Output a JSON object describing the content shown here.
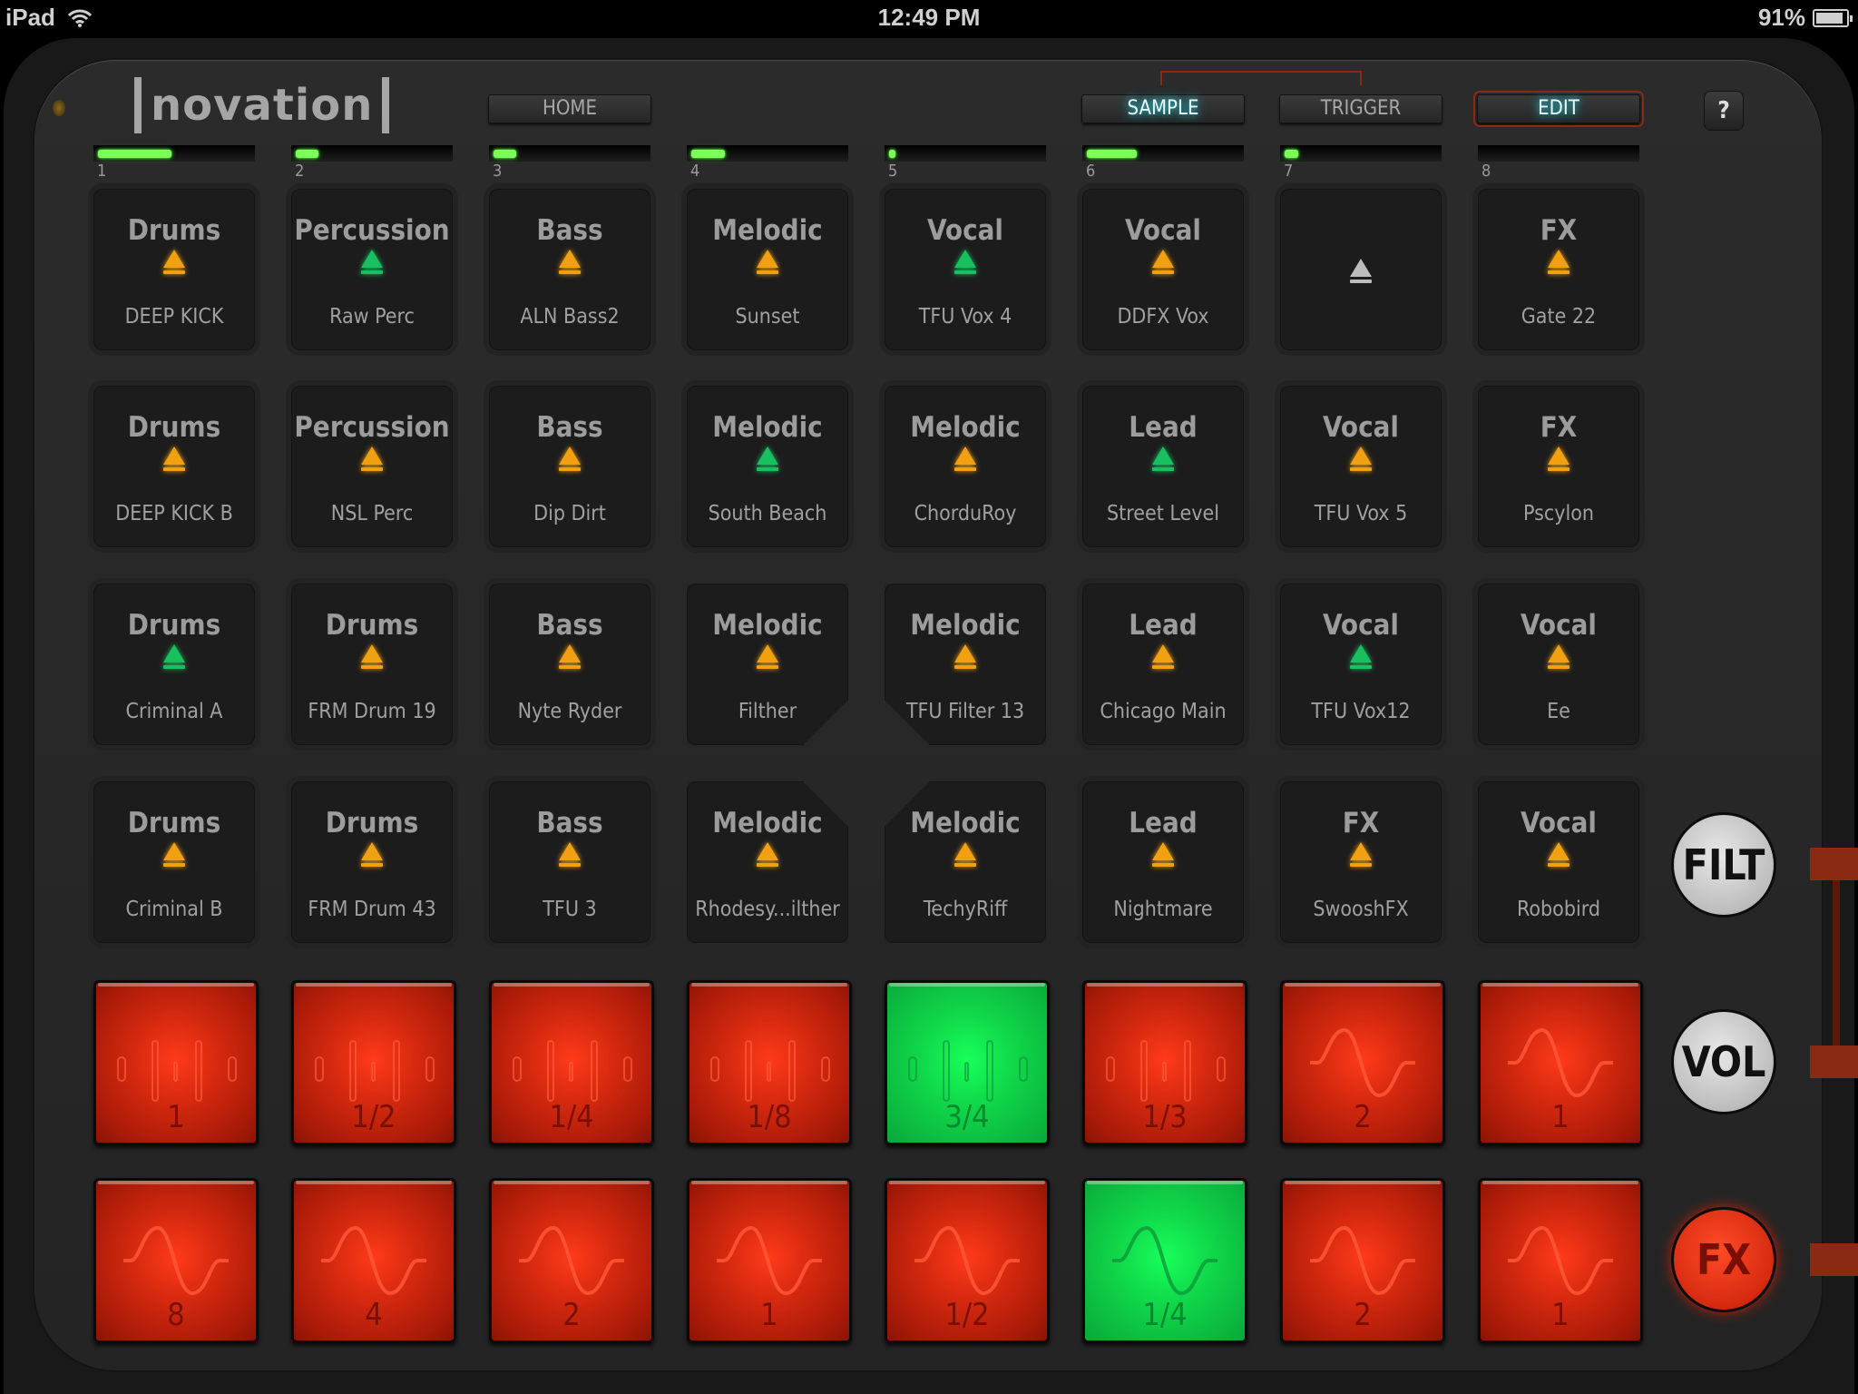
{
  "status_bar": {
    "device": "iPad",
    "wifi_icon": "wifi-icon",
    "time": "12:49 PM",
    "battery_text": "91%",
    "battery_level": 0.91
  },
  "header": {
    "logo": "novation",
    "home_label": "HOME",
    "sample_label": "SAMPLE",
    "trigger_label": "TRIGGER",
    "edit_label": "EDIT",
    "help_label": "?",
    "active_mode": "SAMPLE"
  },
  "colors": {
    "meter_green": "#7dff5a",
    "eject_orange": "#f0a010",
    "eject_green": "#18c060",
    "eject_empty": "#bdbdbd",
    "pad_red": "#d82a10",
    "pad_green": "#10d84a",
    "mode_highlight": "#2fd0d8",
    "bracket_red": "#8a2a14"
  },
  "meters": [
    {
      "label": "1",
      "level": 0.48
    },
    {
      "label": "2",
      "level": 0.15
    },
    {
      "label": "3",
      "level": 0.15
    },
    {
      "label": "4",
      "level": 0.22
    },
    {
      "label": "5",
      "level": 0.04
    },
    {
      "label": "6",
      "level": 0.33
    },
    {
      "label": "7",
      "level": 0.09
    },
    {
      "label": "8",
      "level": 0.0
    }
  ],
  "sample_pads": [
    [
      {
        "category": "Drums",
        "name": "DEEP KICK",
        "state": "orange"
      },
      {
        "category": "Percussion",
        "name": "Raw Perc",
        "state": "green"
      },
      {
        "category": "Bass",
        "name": "ALN Bass2",
        "state": "orange"
      },
      {
        "category": "Melodic",
        "name": "Sunset",
        "state": "orange"
      },
      {
        "category": "Vocal",
        "name": "TFU Vox 4",
        "state": "green"
      },
      {
        "category": "Vocal",
        "name": "DDFX Vox",
        "state": "orange"
      },
      {
        "category": "",
        "name": "",
        "state": "empty"
      },
      {
        "category": "FX",
        "name": "Gate 22",
        "state": "orange"
      }
    ],
    [
      {
        "category": "Drums",
        "name": "DEEP KICK B",
        "state": "orange"
      },
      {
        "category": "Percussion",
        "name": "NSL Perc",
        "state": "orange"
      },
      {
        "category": "Bass",
        "name": "Dip Dirt",
        "state": "orange"
      },
      {
        "category": "Melodic",
        "name": "South Beach",
        "state": "green"
      },
      {
        "category": "Melodic",
        "name": "ChorduRoy",
        "state": "orange"
      },
      {
        "category": "Lead",
        "name": "Street Level",
        "state": "green"
      },
      {
        "category": "Vocal",
        "name": "TFU Vox 5",
        "state": "orange"
      },
      {
        "category": "FX",
        "name": "Pscylon",
        "state": "orange"
      }
    ],
    [
      {
        "category": "Drums",
        "name": "Criminal A",
        "state": "green"
      },
      {
        "category": "Drums",
        "name": "FRM Drum 19",
        "state": "orange"
      },
      {
        "category": "Bass",
        "name": "Nyte Ryder",
        "state": "orange"
      },
      {
        "category": "Melodic",
        "name": "Filther",
        "state": "orange"
      },
      {
        "category": "Melodic",
        "name": "TFU Filter 13",
        "state": "orange"
      },
      {
        "category": "Lead",
        "name": "Chicago Main",
        "state": "orange"
      },
      {
        "category": "Vocal",
        "name": "TFU Vox12",
        "state": "green"
      },
      {
        "category": "Vocal",
        "name": "Ee",
        "state": "orange"
      }
    ],
    [
      {
        "category": "Drums",
        "name": "Criminal B",
        "state": "orange"
      },
      {
        "category": "Drums",
        "name": "FRM Drum 43",
        "state": "orange"
      },
      {
        "category": "Bass",
        "name": "TFU 3",
        "state": "orange"
      },
      {
        "category": "Melodic",
        "name": "Rhodesy...ilther",
        "state": "orange"
      },
      {
        "category": "Melodic",
        "name": "TechyRiff",
        "state": "orange"
      },
      {
        "category": "Lead",
        "name": "Nightmare",
        "state": "orange"
      },
      {
        "category": "FX",
        "name": "SwooshFX",
        "state": "orange"
      },
      {
        "category": "Vocal",
        "name": "Robobird",
        "state": "orange"
      }
    ]
  ],
  "effect_pads": [
    [
      {
        "value": "1",
        "icon": "gate-icon",
        "active": false
      },
      {
        "value": "1/2",
        "icon": "gate-icon",
        "active": false
      },
      {
        "value": "1/4",
        "icon": "gate-icon",
        "active": false
      },
      {
        "value": "1/8",
        "icon": "gate-icon",
        "active": false
      },
      {
        "value": "3/4",
        "icon": "gate-icon",
        "active": true
      },
      {
        "value": "1/3",
        "icon": "gate-icon",
        "active": false
      },
      {
        "value": "2",
        "icon": "sine-wave-icon",
        "active": false
      },
      {
        "value": "1",
        "icon": "sine-wave-icon",
        "active": false
      }
    ],
    [
      {
        "value": "8",
        "icon": "sine-wave-icon",
        "active": false
      },
      {
        "value": "4",
        "icon": "sine-wave-icon",
        "active": false
      },
      {
        "value": "2",
        "icon": "sine-wave-icon",
        "active": false
      },
      {
        "value": "1",
        "icon": "sine-wave-icon",
        "active": false
      },
      {
        "value": "1/2",
        "icon": "sine-wave-icon",
        "active": false
      },
      {
        "value": "1/4",
        "icon": "sine-wave-icon",
        "active": true
      },
      {
        "value": "2",
        "icon": "sine-wave-icon",
        "active": false
      },
      {
        "value": "1",
        "icon": "sine-wave-icon",
        "active": false
      }
    ]
  ],
  "side_buttons": [
    {
      "label": "FILT",
      "style": "silver"
    },
    {
      "label": "VOL",
      "style": "silver"
    },
    {
      "label": "FX",
      "style": "red"
    }
  ]
}
